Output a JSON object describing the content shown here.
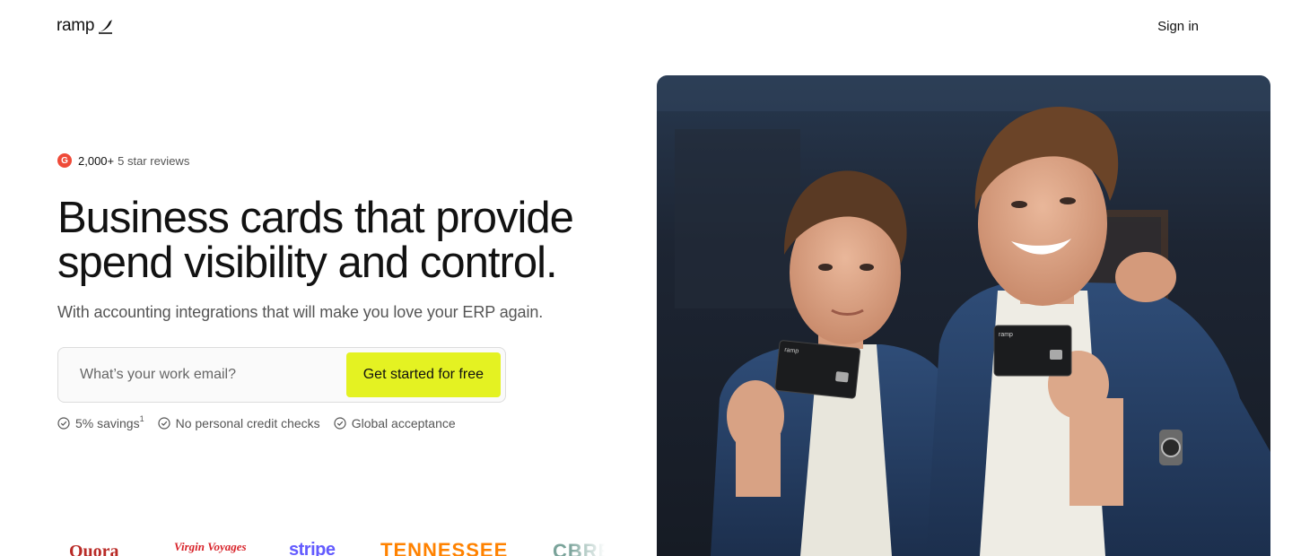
{
  "header": {
    "logo_text": "ramp",
    "signin_label": "Sign in"
  },
  "reviews": {
    "count": "2,000+",
    "label": "5 star reviews",
    "badge_letter": "G"
  },
  "hero": {
    "headline": "Business cards that provide spend visibility and control.",
    "subhead": "With accounting integrations that will make you love your ERP again.",
    "card_label": "ramp"
  },
  "signup": {
    "email_placeholder": "What’s your work email?",
    "cta_label": "Get started for free"
  },
  "benefits": [
    {
      "label": "5% savings",
      "footnote": "1"
    },
    {
      "label": "No personal credit checks"
    },
    {
      "label": "Global acceptance"
    }
  ],
  "customer_logos": [
    "Quora",
    "Virgin Voyages",
    "stripe",
    "TENNESSEE",
    "CBRE"
  ],
  "colors": {
    "accent": "#e4f222",
    "text": "#121212",
    "muted": "#555555",
    "g2_red": "#ef4a38"
  },
  "icons": [
    "ramp-logo-icon",
    "g2-icon",
    "check-circle-icon"
  ]
}
